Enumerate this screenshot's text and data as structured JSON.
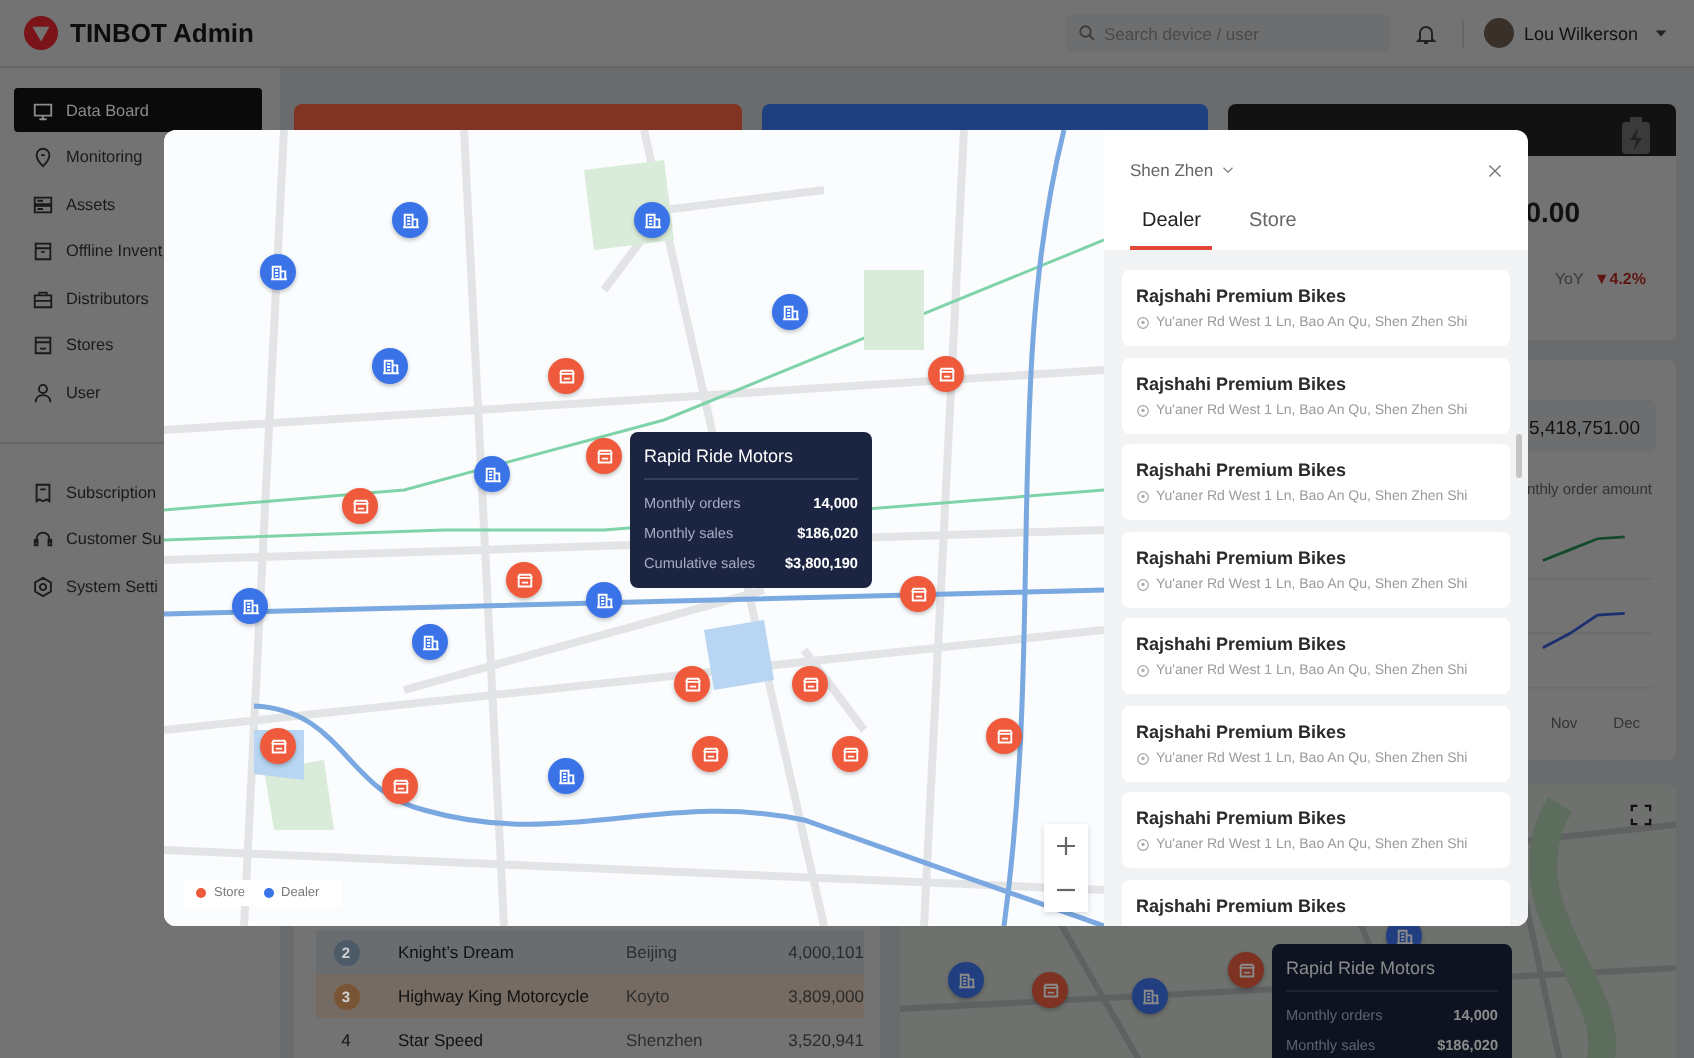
{
  "header": {
    "title": "TINBOT Admin",
    "search": {
      "placeholder": "Search device / user"
    },
    "user": {
      "name": "Lou Wilkerson"
    }
  },
  "sidebar": {
    "sections": [
      {
        "items": [
          {
            "label": "Data Board",
            "selected": true
          },
          {
            "label": "Monitoring",
            "selected": false
          },
          {
            "label": "Assets",
            "selected": false
          },
          {
            "label": "Offline Invent",
            "selected": false
          },
          {
            "label": "Distributors",
            "selected": false
          },
          {
            "label": "Stores",
            "selected": false
          },
          {
            "label": "User",
            "selected": false
          }
        ]
      },
      {
        "items": [
          {
            "label": "Subscription",
            "selected": false
          },
          {
            "label": "Customer Su",
            "selected": false
          },
          {
            "label": "System Setti",
            "selected": false
          }
        ]
      }
    ]
  },
  "dashboard": {
    "cards": [
      {
        "color": "#823422"
      },
      {
        "color": "#1e3f80"
      },
      {
        "color": "#121212",
        "value": "0.00",
        "yoy_label": "YoY",
        "yoy_change": "▼4.2%"
      }
    ],
    "order_card": {
      "value": "5,418,751.00",
      "caption": "nthly order amount",
      "axis_labels": [
        "Nov",
        "Dec"
      ]
    },
    "ranking": {
      "rows": [
        {
          "kind": "medal",
          "color": "#4d5b69",
          "rank": "2",
          "name": "Knight’s Dream",
          "city": "Beijing",
          "value": "4,000,101"
        },
        {
          "kind": "medal",
          "color": "#7a5535",
          "rank": "3",
          "name": "Highway King Motorcycle",
          "city": "Koyto",
          "value": "3,809,000"
        },
        {
          "kind": "plain",
          "rank": "4",
          "name": "Star Speed",
          "city": "Shenzhen",
          "value": "3,520,941"
        }
      ]
    },
    "map_card": {
      "markers": [
        {
          "kind": "dealer"
        },
        {
          "kind": "store"
        },
        {
          "kind": "dealer"
        },
        {
          "kind": "store"
        },
        {
          "kind": "dealer"
        }
      ],
      "tooltip": {
        "title": "Rapid Ride Motors",
        "rows": [
          {
            "label": "Monthly orders",
            "value": "14,000"
          },
          {
            "label": "Monthly sales",
            "value": "$186,020"
          }
        ]
      }
    }
  },
  "modal": {
    "map": {
      "markers": [
        {
          "kind": "dealer"
        },
        {
          "kind": "dealer"
        },
        {
          "kind": "dealer"
        },
        {
          "kind": "dealer"
        },
        {
          "kind": "dealer"
        },
        {
          "kind": "dealer"
        },
        {
          "kind": "dealer"
        },
        {
          "kind": "dealer"
        },
        {
          "kind": "dealer"
        },
        {
          "kind": "dealer"
        },
        {
          "kind": "store"
        },
        {
          "kind": "store"
        },
        {
          "kind": "store"
        },
        {
          "kind": "store"
        },
        {
          "kind": "store"
        },
        {
          "kind": "store"
        },
        {
          "kind": "store"
        },
        {
          "kind": "store"
        },
        {
          "kind": "store"
        },
        {
          "kind": "store"
        },
        {
          "kind": "store"
        },
        {
          "kind": "store"
        },
        {
          "kind": "store"
        }
      ],
      "tooltip": {
        "title": "Rapid Ride Motors",
        "rows": [
          {
            "label": "Monthly orders",
            "value": "14,000"
          },
          {
            "label": "Monthly sales",
            "value": "$186,020"
          },
          {
            "label": "Cumulative sales",
            "value": "$3,800,190"
          }
        ]
      },
      "legend": [
        {
          "label": "Store",
          "color": "#ef5a3c"
        },
        {
          "label": "Dealer",
          "color": "#3a73e8"
        }
      ]
    },
    "panel": {
      "city": "Shen Zhen",
      "tabs": [
        {
          "label": "Dealer",
          "selected": true
        },
        {
          "label": "Store",
          "selected": false
        }
      ],
      "items": [
        {
          "name": "Rajshahi Premium Bikes",
          "address": "Yu'aner Rd West 1 Ln, Bao An Qu, Shen Zhen Shi"
        },
        {
          "name": "Rajshahi Premium Bikes",
          "address": "Yu'aner Rd West 1 Ln, Bao An Qu, Shen Zhen Shi"
        },
        {
          "name": "Rajshahi Premium Bikes",
          "address": "Yu'aner Rd West 1 Ln, Bao An Qu, Shen Zhen Shi"
        },
        {
          "name": "Rajshahi Premium Bikes",
          "address": "Yu'aner Rd West 1 Ln, Bao An Qu, Shen Zhen Shi"
        },
        {
          "name": "Rajshahi Premium Bikes",
          "address": "Yu'aner Rd West 1 Ln, Bao An Qu, Shen Zhen Shi"
        },
        {
          "name": "Rajshahi Premium Bikes",
          "address": "Yu'aner Rd West 1 Ln, Bao An Qu, Shen Zhen Shi"
        },
        {
          "name": "Rajshahi Premium Bikes",
          "address": "Yu'aner Rd West 1 Ln, Bao An Qu, Shen Zhen Shi"
        },
        {
          "name": "Rajshahi Premium Bikes"
        }
      ]
    }
  }
}
